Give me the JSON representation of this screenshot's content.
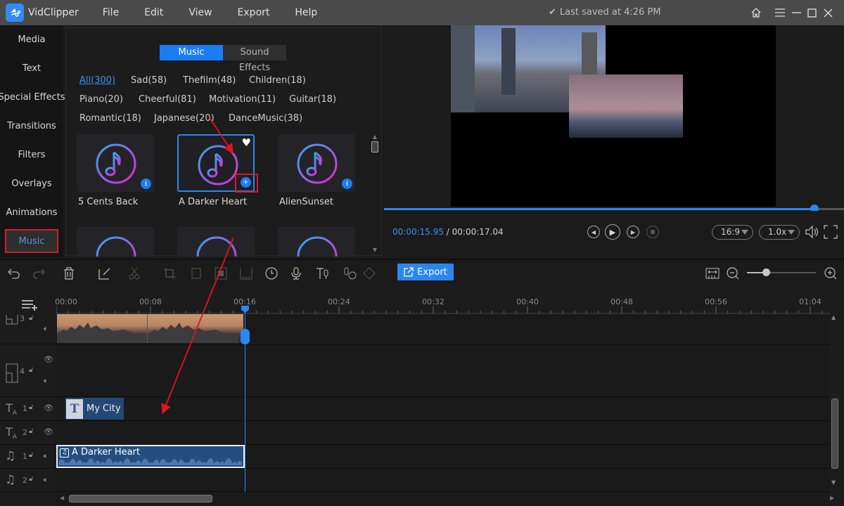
{
  "app": {
    "name": "VidClipper",
    "saved_status": "Last saved at 4:26 PM"
  },
  "menu": [
    "File",
    "Edit",
    "View",
    "Export",
    "Help"
  ],
  "left_nav": {
    "items": [
      "Media",
      "Text",
      "Special Effects",
      "Transitions",
      "Filters",
      "Overlays",
      "Animations",
      "Music"
    ],
    "active": "Music"
  },
  "library": {
    "tabs": [
      {
        "label": "Music",
        "active": true
      },
      {
        "label": "Sound Effects",
        "active": false
      }
    ],
    "categories": [
      {
        "label": "All(300)",
        "selected": true
      },
      {
        "label": "Sad(58)"
      },
      {
        "label": "Thefilm(48)"
      },
      {
        "label": "Children(18)"
      },
      {
        "label": "Piano(20)"
      },
      {
        "label": "Cheerful(81)"
      },
      {
        "label": "Motivation(11)"
      },
      {
        "label": "Guitar(18)"
      },
      {
        "label": "Romantic(18)"
      },
      {
        "label": "Japanese(20)"
      },
      {
        "label": "DanceMusic(38)"
      }
    ],
    "tracks": [
      {
        "title": "5 Cents Back",
        "action": "download"
      },
      {
        "title": "A Darker Heart",
        "action": "add",
        "selected": true,
        "favorited": true
      },
      {
        "title": "AlienSunset",
        "action": "download"
      }
    ]
  },
  "player": {
    "current_time": "00:00:15.95",
    "separator": " / ",
    "total_time": "00:00:17.04",
    "progress": 0.936,
    "aspect_ratio": "16:9",
    "speed": "1.0x"
  },
  "toolbar": {
    "export_label": "Export",
    "zoom_level": 0.28
  },
  "timeline": {
    "ruler_labels": [
      "00:00",
      "00:08",
      "00:16",
      "00:24",
      "00:32",
      "00:40",
      "00:48",
      "00:56",
      "01:04"
    ],
    "playhead_time": "00:15.95",
    "tracks": [
      {
        "type": "video",
        "index": "3"
      },
      {
        "type": "video",
        "index": "4"
      },
      {
        "type": "text",
        "index": "1"
      },
      {
        "type": "text",
        "index": "2"
      },
      {
        "type": "audio",
        "index": "1"
      },
      {
        "type": "audio",
        "index": "2"
      }
    ],
    "clips": {
      "text_clip": "My City",
      "audio_clip": "A Darker Heart"
    }
  },
  "colors": {
    "accent": "#2a87f2",
    "highlight_box": "#d01e2b",
    "annotation_arrow": "#e0141e"
  }
}
